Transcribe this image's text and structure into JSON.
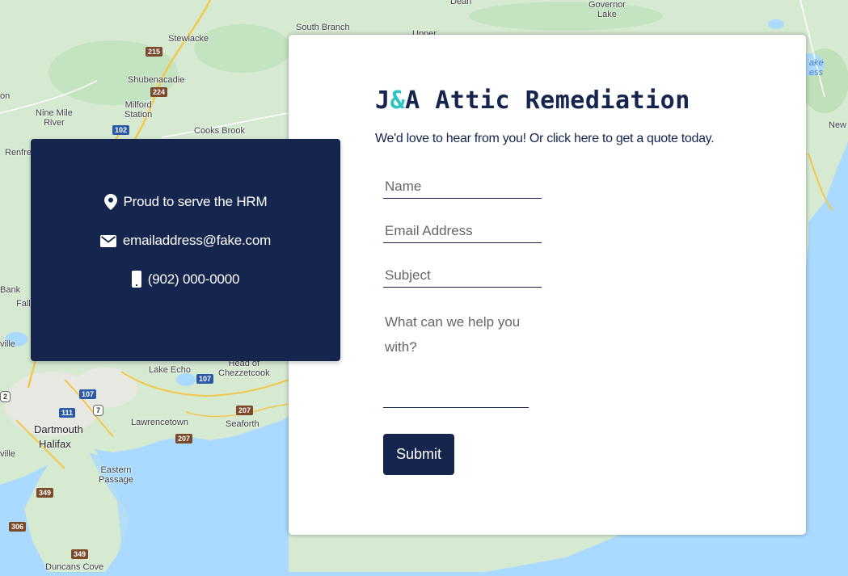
{
  "map": {
    "places": [
      {
        "id": "south-branch",
        "label": "South Branch"
      },
      {
        "id": "upper",
        "label": "Upper"
      },
      {
        "id": "dean",
        "label": "Dean"
      },
      {
        "id": "governor-lake",
        "label": "Governor\nLake"
      },
      {
        "id": "stewiacke",
        "label": "Stewiacke"
      },
      {
        "id": "shubenacadie",
        "label": "Shubenacadie"
      },
      {
        "id": "nine-mile-river",
        "label": "Nine Mile\nRiver"
      },
      {
        "id": "milford-station",
        "label": "Milford\nStation"
      },
      {
        "id": "cooks-brook",
        "label": "Cooks Brook"
      },
      {
        "id": "renfrew",
        "label": "Renfre"
      },
      {
        "id": "bank",
        "label": "Bank"
      },
      {
        "id": "fall",
        "label": "Fall"
      },
      {
        "id": "ville1",
        "label": "ville"
      },
      {
        "id": "lake-echo",
        "label": "Lake Echo"
      },
      {
        "id": "head-of-chezzetcook",
        "label": "Head of\nChezzetcook"
      },
      {
        "id": "dartmouth",
        "label": "Dartmouth"
      },
      {
        "id": "halifax",
        "label": "Halifax"
      },
      {
        "id": "lawrencetown",
        "label": "Lawrencetown"
      },
      {
        "id": "seaforth",
        "label": "Seaforth"
      },
      {
        "id": "eastern-passage",
        "label": "Eastern\nPassage"
      },
      {
        "id": "ville2",
        "label": "ville"
      },
      {
        "id": "duncans-cove",
        "label": "Duncans Cove"
      },
      {
        "id": "new",
        "label": "New"
      },
      {
        "id": "lake-ess",
        "label": "ake\ness"
      },
      {
        "id": "on",
        "label": "on"
      }
    ],
    "shields": [
      {
        "id": "r215",
        "label": "215"
      },
      {
        "id": "r224",
        "label": "224"
      },
      {
        "id": "r102",
        "label": "102"
      },
      {
        "id": "r107a",
        "label": "107"
      },
      {
        "id": "r107b",
        "label": "107"
      },
      {
        "id": "r111",
        "label": "111"
      },
      {
        "id": "r7",
        "label": "7"
      },
      {
        "id": "r207a",
        "label": "207"
      },
      {
        "id": "r207b",
        "label": "207"
      },
      {
        "id": "r349a",
        "label": "349"
      },
      {
        "id": "r349b",
        "label": "349"
      },
      {
        "id": "r306",
        "label": "306"
      },
      {
        "id": "r2",
        "label": "2"
      }
    ]
  },
  "contact": {
    "service_area": "Proud to serve the HRM",
    "email": "emailaddress@fake.com",
    "phone": "(902) 000-0000"
  },
  "form": {
    "brand_prefix": "J",
    "brand_amp": "&",
    "brand_suffix": "A Attic Remediation",
    "tagline": "We'd love to hear from you! Or click here to get a quote today.",
    "name_placeholder": "Name",
    "email_placeholder": "Email Address",
    "subject_placeholder": "Subject",
    "message_placeholder": "What can we help you with?",
    "submit_label": "Submit"
  },
  "colors": {
    "navy": "#15254e",
    "accent": "#2ec4c6",
    "land": "#d9ecd5",
    "water": "#aadaff"
  },
  "icons": {
    "location": "map-pin-icon",
    "email": "envelope-icon",
    "phone": "mobile-phone-icon"
  }
}
